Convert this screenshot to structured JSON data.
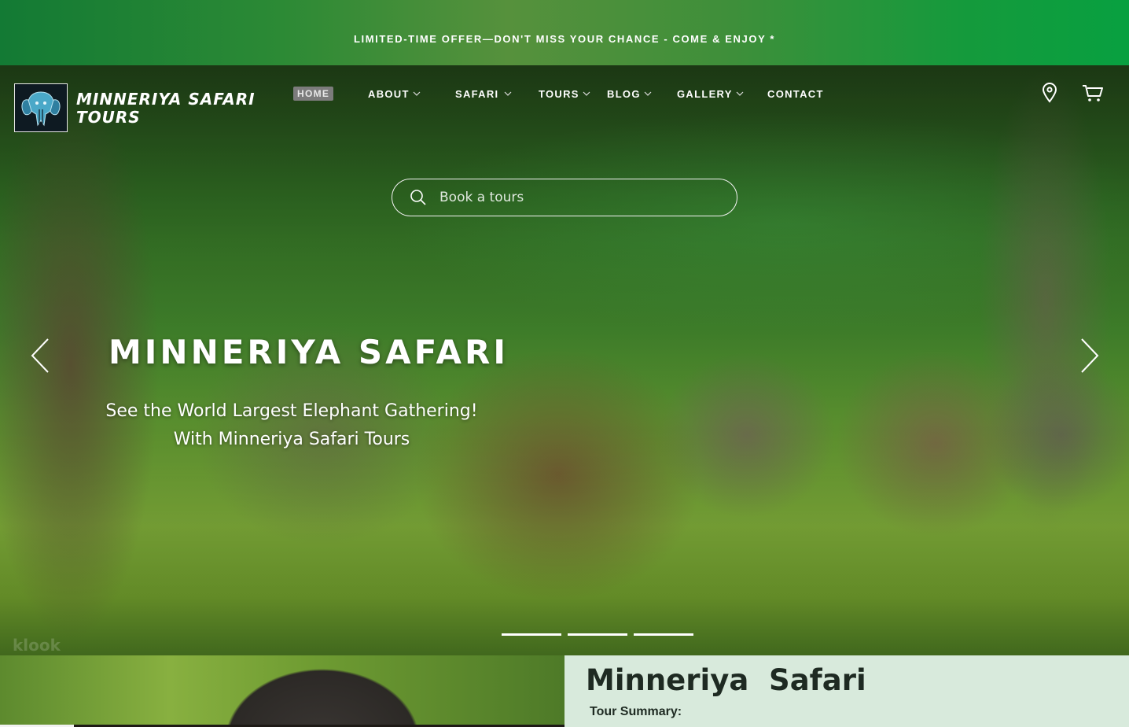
{
  "promo": {
    "text": "LIMITED-TIME OFFER—DON'T MISS YOUR CHANCE - COME & ENJOY *"
  },
  "brand": {
    "line1": "MINNERIYA SAFARI",
    "line2": "TOURS"
  },
  "nav": {
    "items": [
      {
        "label": "HOME",
        "active": true,
        "dropdown": false
      },
      {
        "label": "ABOUT",
        "active": false,
        "dropdown": true
      },
      {
        "label": "SAFARI",
        "active": false,
        "dropdown": true
      },
      {
        "label": "TOURS",
        "active": false,
        "dropdown": true
      },
      {
        "label": "BLOG",
        "active": false,
        "dropdown": true
      },
      {
        "label": "GALLERY",
        "active": false,
        "dropdown": true
      },
      {
        "label": "CONTACT",
        "active": false,
        "dropdown": false
      }
    ],
    "icons": [
      "location-pin-icon",
      "shopping-cart-icon"
    ]
  },
  "search": {
    "placeholder": "Book a tours",
    "value": ""
  },
  "hero": {
    "title": "MINNERIYA SAFARI",
    "subtitle_line1": "See the World Largest Elephant Gathering!",
    "subtitle_line2": "With Minneriya Safari Tours",
    "slide_count": 3,
    "watermark": "klook"
  },
  "section": {
    "title": "Minneriya  Safari",
    "summary_label": "Tour Summary:"
  },
  "colors": {
    "promo_start": "#137a34",
    "promo_end": "#08a040",
    "section_bg": "#d8eadc",
    "heading": "#1e2a22"
  }
}
